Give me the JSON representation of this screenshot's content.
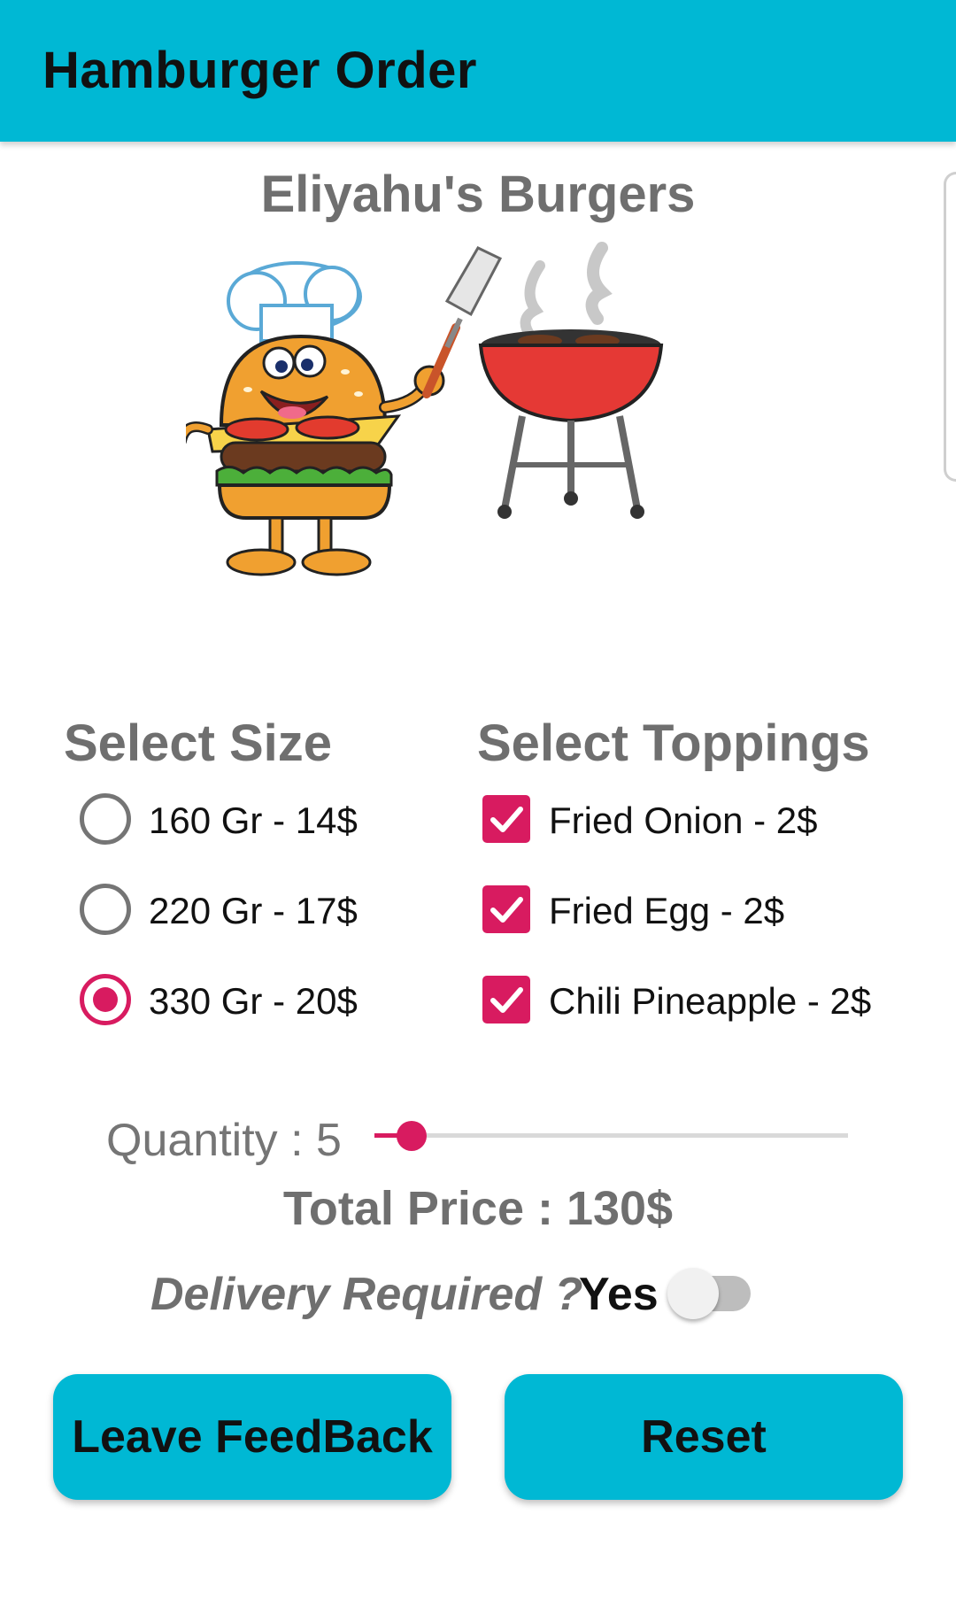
{
  "app_bar": {
    "title": "Hamburger Order"
  },
  "shop": {
    "name": "Eliyahu's Burgers"
  },
  "size_section": {
    "title": "Select Size",
    "options": [
      {
        "label": "160 Gr - 14$",
        "selected": false
      },
      {
        "label": "220 Gr - 17$",
        "selected": false
      },
      {
        "label": "330 Gr - 20$",
        "selected": true
      }
    ]
  },
  "toppings_section": {
    "title": "Select Toppings",
    "options": [
      {
        "label": "Fried Onion - 2$",
        "checked": true
      },
      {
        "label": "Fried Egg - 2$",
        "checked": true
      },
      {
        "label": "Chili Pineapple - 2$",
        "checked": true
      }
    ]
  },
  "quantity": {
    "label": "Quantity : 5"
  },
  "total": {
    "label": "Total Price : 130$"
  },
  "delivery": {
    "question": "Delivery Required ?",
    "switch_label": "Yes",
    "enabled": false
  },
  "buttons": {
    "feedback": "Leave FeedBack",
    "reset": "Reset"
  },
  "colors": {
    "primary": "#00b8d4",
    "accent": "#d81b60",
    "title_gray": "#6f6f6f"
  }
}
